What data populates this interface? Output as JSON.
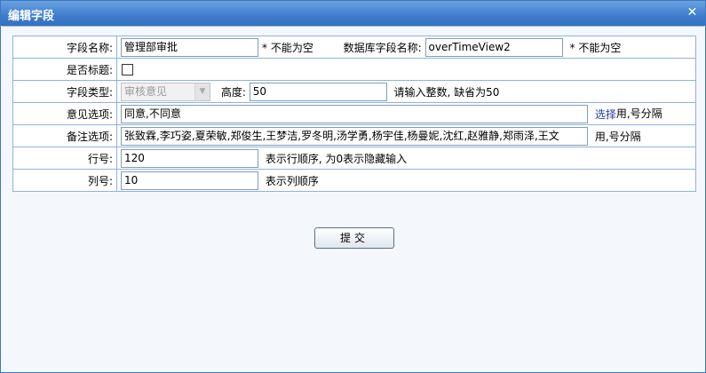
{
  "dialog": {
    "title": "编辑字段",
    "close": "✕"
  },
  "form": {
    "field_name_label": "字段名称:",
    "field_name_value": "管理部审批",
    "field_name_note": "* 不能为空",
    "db_field_label": "数据库字段名称:",
    "db_field_value": "overTimeView2",
    "db_field_note": "* 不能为空",
    "is_title_label": "是否标题:",
    "is_title_checked": false,
    "field_type_label": "字段类型:",
    "field_type_value": "审核意见",
    "height_label": "高度:",
    "height_value": "50",
    "height_note": "请输入整数, 缺省为50",
    "opinion_label": "意见选项:",
    "opinion_value": "同意,不同意",
    "opinion_select_link": "选择",
    "opinion_note": "用,号分隔",
    "remark_label": "备注选项:",
    "remark_value": "张致霖,李巧姿,夏荣敏,郑俊生,王梦洁,罗冬明,汤学勇,杨宇佳,杨曼妮,沈红,赵雅静,郑雨泽,王文",
    "remark_note": "用,号分隔",
    "row_label": "行号:",
    "row_value": "120",
    "row_note": "表示行顺序, 为0表示隐藏输入",
    "col_label": "列号:",
    "col_value": "10",
    "col_note": "表示列顺序"
  },
  "submit_label": "提交"
}
